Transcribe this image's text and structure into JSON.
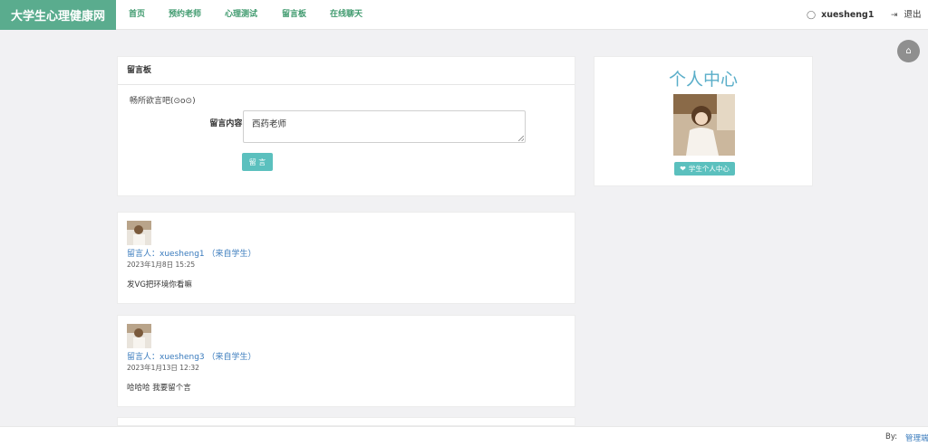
{
  "brand": "大学生心理健康网",
  "nav": [
    "首页",
    "预约老师",
    "心理测试",
    "留言板",
    "在线聊天"
  ],
  "user": {
    "name": "xuesheng1",
    "logout": "退出"
  },
  "board": {
    "title": "留言板",
    "hint": "畅所欲言吧(⊙o⊙)",
    "field_label": "留言内容:",
    "field_value": "西药老师",
    "submit": "留 言"
  },
  "messages": [
    {
      "author": "留言人：xuesheng1 （来自学生）",
      "time": "2023年1月8日 15:25",
      "content": "发VG把环境你看嘛"
    },
    {
      "author": "留言人：xuesheng3 （来自学生）",
      "time": "2023年1月13日 12:32",
      "content": "哈哈哈 我要留个言"
    }
  ],
  "personal": {
    "title": "个人中心",
    "button": "学生个人中心"
  },
  "footer": {
    "by": "By:",
    "admin": "管理端"
  },
  "colors": {
    "brand": "#5aac8e",
    "nav": "#3f9a6e",
    "link": "#3a7bbd",
    "button": "#5bc0be",
    "title": "#5aaec9"
  },
  "icons": {
    "user": "user-icon",
    "logout": "sign-out-icon",
    "home": "home-icon",
    "heart": "heart-icon"
  }
}
